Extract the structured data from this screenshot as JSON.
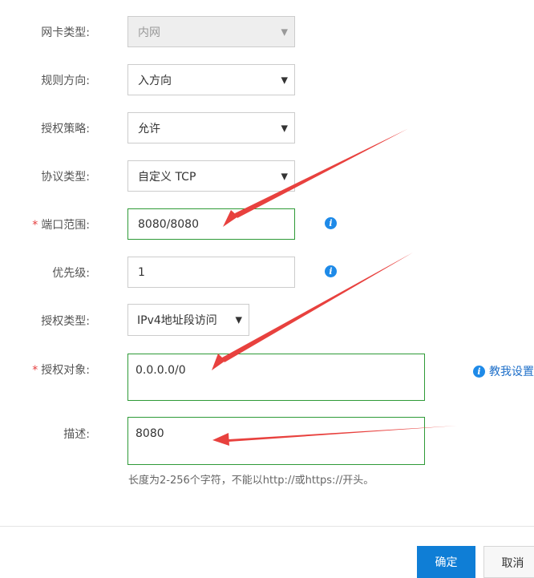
{
  "form": {
    "nic_type": {
      "label": "网卡类型:",
      "value": "内网",
      "disabled": true
    },
    "rule_direction": {
      "label": "规则方向:",
      "value": "入方向"
    },
    "auth_policy": {
      "label": "授权策略:",
      "value": "允许"
    },
    "protocol_type": {
      "label": "协议类型:",
      "value": "自定义 TCP"
    },
    "port_range": {
      "required_mark": "*",
      "label": "端口范围:",
      "value": "8080/8080"
    },
    "priority": {
      "label": "优先级:",
      "value": "1"
    },
    "auth_type": {
      "label": "授权类型:",
      "value": "IPv4地址段访问"
    },
    "auth_object": {
      "required_mark": "*",
      "label": "授权对象:",
      "value": "0.0.0.0/0",
      "help_link": "教我设置"
    },
    "description": {
      "label": "描述:",
      "value": "8080",
      "hint": "长度为2-256个字符，不能以http://或https://开头。"
    }
  },
  "info_icon_glyph": "i",
  "footer": {
    "confirm_label": "确定",
    "cancel_label": "取消"
  },
  "colors": {
    "focus_border": "#2e9a37",
    "primary_button": "#0f7ed6",
    "info_icon": "#1e8ae8",
    "annotation_arrow": "#e8413e"
  }
}
